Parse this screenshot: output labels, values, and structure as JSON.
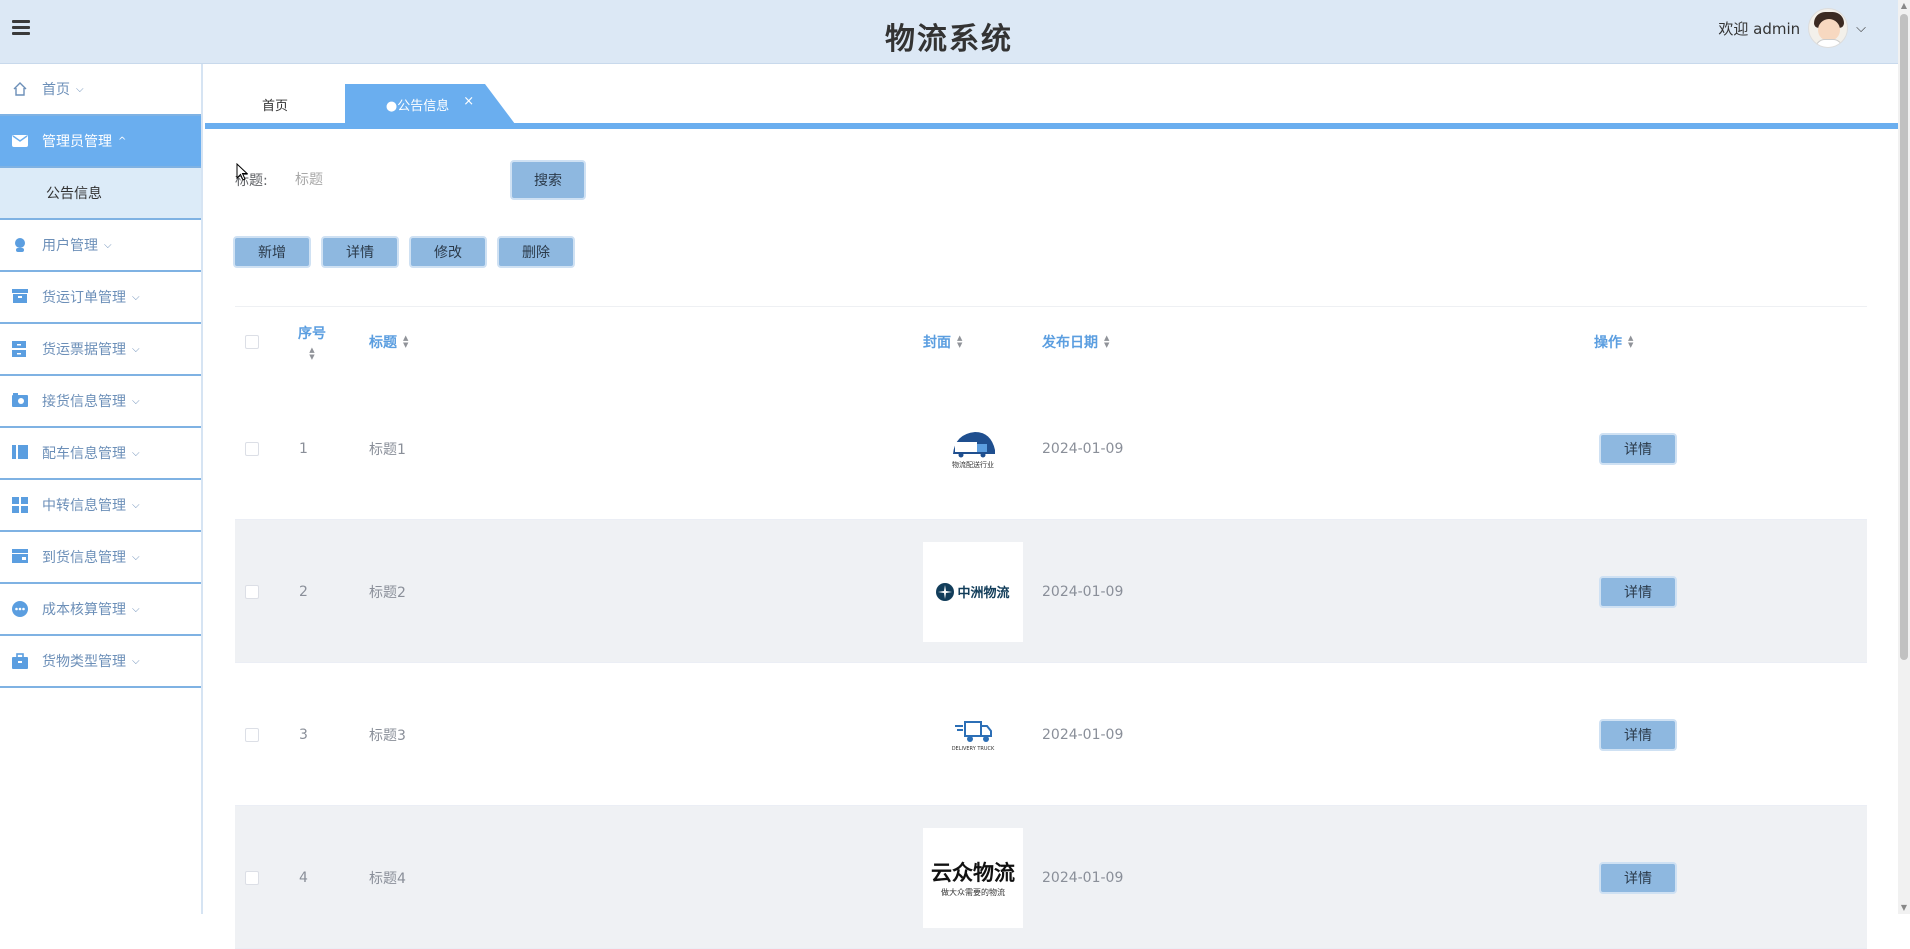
{
  "header": {
    "title": "物流系统",
    "welcome": "欢迎 admin"
  },
  "sidebar": {
    "items": [
      {
        "label": "首页",
        "arrow": "⌵"
      },
      {
        "label": "管理员管理",
        "arrow": "^"
      },
      {
        "label": "公告信息"
      },
      {
        "label": "用户管理",
        "arrow": "⌵"
      },
      {
        "label": "货运订单管理",
        "arrow": "⌵"
      },
      {
        "label": "货运票据管理",
        "arrow": "⌵"
      },
      {
        "label": "接货信息管理",
        "arrow": "⌵"
      },
      {
        "label": "配车信息管理",
        "arrow": "⌵"
      },
      {
        "label": "中转信息管理",
        "arrow": "⌵"
      },
      {
        "label": "到货信息管理",
        "arrow": "⌵"
      },
      {
        "label": "成本核算管理",
        "arrow": "⌵"
      },
      {
        "label": "货物类型管理",
        "arrow": "⌵"
      }
    ]
  },
  "tabs": {
    "home": "首页",
    "active": "●公告信息",
    "close": "×"
  },
  "search": {
    "label": "标题:",
    "placeholder": "标题",
    "button": "搜索"
  },
  "actions": {
    "add": "新增",
    "detail": "详情",
    "edit": "修改",
    "delete": "删除"
  },
  "table": {
    "headers": {
      "index": "序号",
      "title": "标题",
      "cover": "封面",
      "date": "发布日期",
      "op": "操作"
    },
    "rows": [
      {
        "index": "1",
        "title": "标题1",
        "date": "2024-01-09",
        "cover_text": "物流配送行业",
        "detail": "详情"
      },
      {
        "index": "2",
        "title": "标题2",
        "date": "2024-01-09",
        "cover_text": "中洲物流",
        "detail": "详情"
      },
      {
        "index": "3",
        "title": "标题3",
        "date": "2024-01-09",
        "cover_text": "DELIVERY TRUCK",
        "detail": "详情"
      },
      {
        "index": "4",
        "title": "标题4",
        "date": "2024-01-09",
        "cover_text": "云众物流",
        "cover_sub": "做大众需要的物流",
        "detail": "详情"
      }
    ]
  },
  "colors": {
    "accent": "#6aaeef",
    "header_bg": "#dce8f5",
    "button_bg": "#8eb8e0"
  }
}
